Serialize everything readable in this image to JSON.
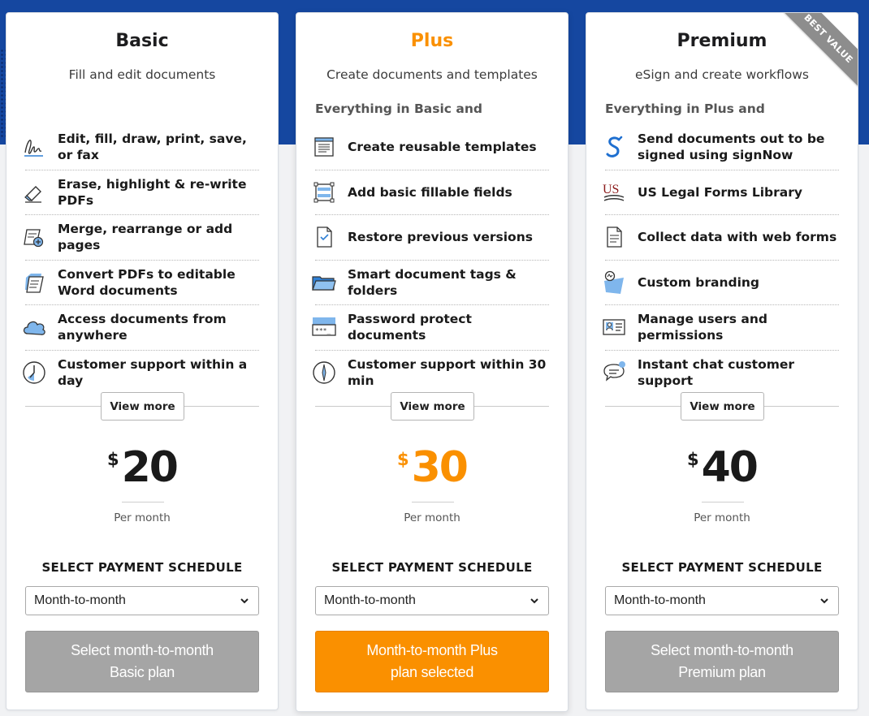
{
  "colors": {
    "header_band": "#1547a0",
    "accent_orange": "#fa9000",
    "button_gray": "#a5a5a5"
  },
  "plans": [
    {
      "name": "Basic",
      "name_color": "#1a1a1a",
      "description": "Fill and edit documents",
      "intro": "",
      "features": [
        {
          "icon": "signature-icon",
          "text": "Edit, fill, draw, print, save, or fax"
        },
        {
          "icon": "eraser-icon",
          "text": "Erase, highlight & re-write PDFs"
        },
        {
          "icon": "add-page-icon",
          "text": "Merge, rearrange or add pages"
        },
        {
          "icon": "convert-document-icon",
          "text": "Convert PDFs to editable Word documents"
        },
        {
          "icon": "cloud-icon",
          "text": "Access documents from anywhere"
        },
        {
          "icon": "clock-icon",
          "text": "Customer support within a day"
        }
      ],
      "view_more": "View more",
      "currency": "$",
      "price": "20",
      "price_color": "#1a1a1a",
      "per_month": "Per month",
      "schedule_label": "SELECT PAYMENT SCHEDULE",
      "schedule_value": "Month-to-month",
      "cta_line1": "Select month-to-month",
      "cta_line2": "Basic plan"
    },
    {
      "name": "Plus",
      "name_color": "#fa9000",
      "description": "Create documents and templates",
      "intro": "Everything in Basic and",
      "features": [
        {
          "icon": "template-icon",
          "text": "Create reusable templates"
        },
        {
          "icon": "fillable-fields-icon",
          "text": "Add basic fillable fields"
        },
        {
          "icon": "restore-version-icon",
          "text": "Restore previous versions"
        },
        {
          "icon": "folder-icon",
          "text": "Smart document tags & folders"
        },
        {
          "icon": "password-icon",
          "text": "Password protect documents"
        },
        {
          "icon": "compass-clock-icon",
          "text": "Customer support within 30 min"
        }
      ],
      "view_more": "View more",
      "currency": "$",
      "price": "30",
      "price_color": "#fa9000",
      "per_month": "Per month",
      "schedule_label": "SELECT PAYMENT SCHEDULE",
      "schedule_value": "Month-to-month",
      "cta_line1": "Month-to-month Plus",
      "cta_line2": "plan selected"
    },
    {
      "name": "Premium",
      "name_color": "#1a1a1a",
      "description": "eSign and create workflows",
      "intro": "Everything in Plus and",
      "ribbon": "BEST VALUE",
      "features": [
        {
          "icon": "signnow-icon",
          "text": "Send documents out to be signed using signNow"
        },
        {
          "icon": "us-legal-forms-icon",
          "text": "US Legal Forms Library"
        },
        {
          "icon": "web-form-icon",
          "text": "Collect data with web forms"
        },
        {
          "icon": "branding-icon",
          "text": "Custom branding"
        },
        {
          "icon": "users-icon",
          "text": "Manage users and permissions"
        },
        {
          "icon": "chat-icon",
          "text": "Instant chat customer support"
        }
      ],
      "view_more": "View more",
      "currency": "$",
      "price": "40",
      "price_color": "#1a1a1a",
      "per_month": "Per month",
      "schedule_label": "SELECT PAYMENT SCHEDULE",
      "schedule_value": "Month-to-month",
      "cta_line1": "Select month-to-month",
      "cta_line2": "Premium plan"
    }
  ]
}
